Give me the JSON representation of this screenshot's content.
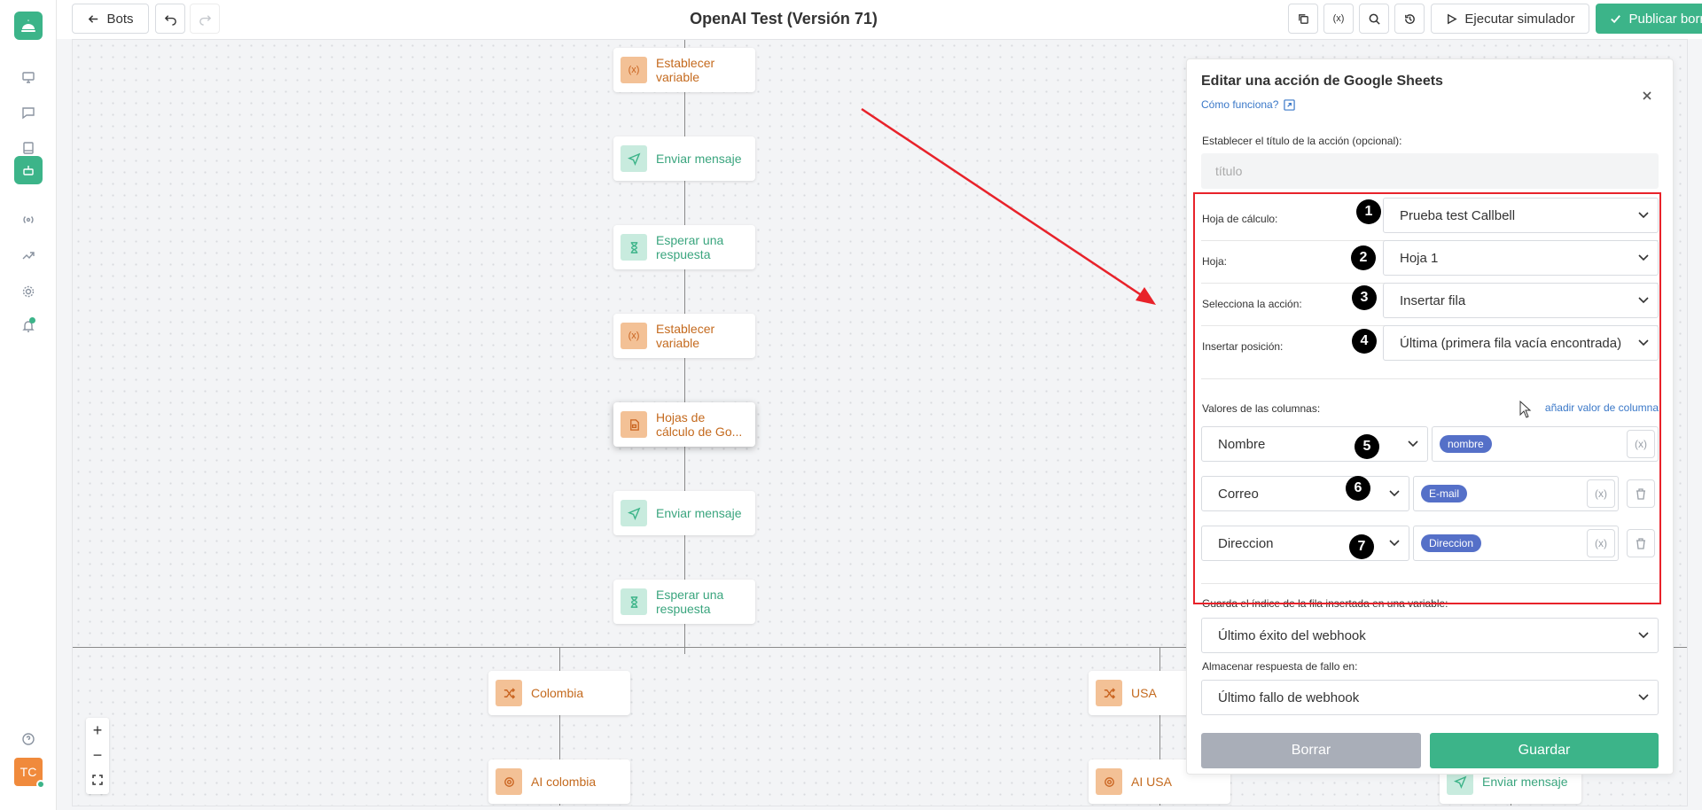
{
  "header": {
    "back_label": "Bots",
    "title": "OpenAI Test (Versión 71)",
    "simulate_label": "Ejecutar simulador",
    "publish_label": "Publicar borrador"
  },
  "sidebar": {
    "avatar_initials": "TC"
  },
  "canvas": {
    "nodes": [
      {
        "label1": "Establecer",
        "label2": "variable"
      },
      {
        "label1": "Enviar mensaje",
        "label2": ""
      },
      {
        "label1": "Esperar una",
        "label2": "respuesta"
      },
      {
        "label1": "Establecer",
        "label2": "variable"
      },
      {
        "label1": "Hojas de",
        "label2": "cálculo de Go..."
      },
      {
        "label1": "Enviar mensaje",
        "label2": ""
      },
      {
        "label1": "Esperar una",
        "label2": "respuesta"
      },
      {
        "label1": "Colombia",
        "label2": ""
      },
      {
        "label1": "USA",
        "label2": ""
      },
      {
        "label1": "AI colombia",
        "label2": ""
      },
      {
        "label1": "AI USA",
        "label2": ""
      },
      {
        "label1": "Enviar mensaje",
        "label2": ""
      }
    ],
    "zoom_in": "+",
    "zoom_out": "−"
  },
  "panel": {
    "title": "Editar una acción de Google Sheets",
    "help_link": "Cómo funciona?",
    "action_title_label": "Establecer el título de la acción (opcional):",
    "action_title_placeholder": "título",
    "spreadsheet_label": "Hoja de cálculo:",
    "spreadsheet_value": "Prueba test Callbell",
    "sheet_label": "Hoja:",
    "sheet_value": "Hoja 1",
    "action_label": "Selecciona la acción:",
    "action_value": "Insertar fila",
    "position_label": "Insertar posición:",
    "position_value": "Última (primera fila vacía encontrada)",
    "columns_label": "Valores de las columnas:",
    "add_column_label": "añadir valor de columna",
    "columns": [
      {
        "name": "Nombre",
        "value": "nombre"
      },
      {
        "name": "Correo",
        "value": "E-mail"
      },
      {
        "name": "Direccion",
        "value": "Direccion"
      }
    ],
    "var_button_label": "(x)",
    "save_index_label": "Guarda el índice de la fila insertada en una variable:",
    "success_value": "Último éxito del webhook",
    "failure_label": "Almacenar respuesta de fallo en:",
    "failure_value": "Último fallo de webhook",
    "delete_label": "Borrar",
    "save_label": "Guardar"
  },
  "annotations": [
    "1",
    "2",
    "3",
    "4",
    "5",
    "6",
    "7"
  ],
  "colors": {
    "accent": "#3cb489",
    "orange_node": "#c46a1e",
    "pill": "#5570c8",
    "highlight_box": "#e8222a"
  }
}
